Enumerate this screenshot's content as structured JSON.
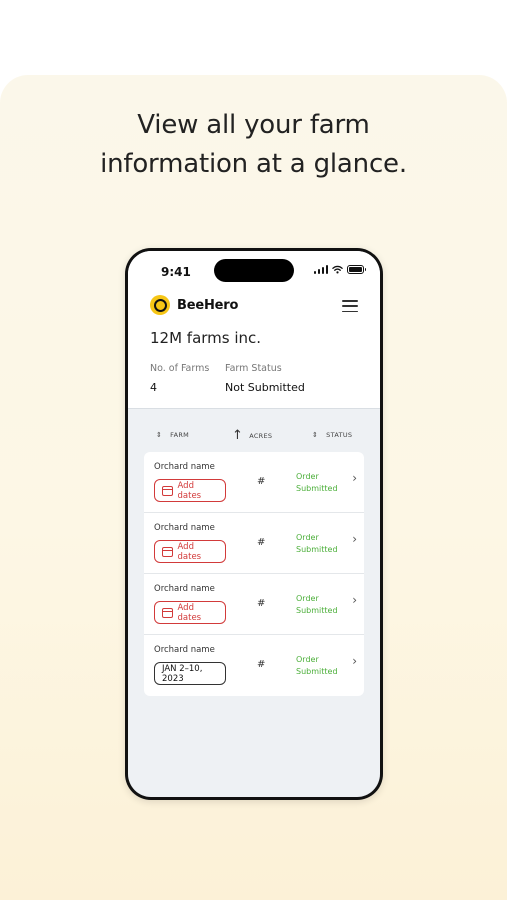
{
  "headline": {
    "line1": "View all your farm",
    "line2": "information at a glance."
  },
  "status_bar": {
    "time": "9:41"
  },
  "app": {
    "brand": "BeeHero",
    "company": "12M farms inc."
  },
  "stats": [
    {
      "label": "No. of Farms",
      "value": "4"
    },
    {
      "label": "Farm Status",
      "value": "Not Submitted"
    }
  ],
  "table": {
    "columns": {
      "farm": "FARM",
      "acres": "ACRES",
      "status": "STATUS"
    },
    "rows": [
      {
        "name": "Orchard name",
        "date": "Add dates",
        "acres": "#",
        "status_1": "Order",
        "status_2": "Submitted"
      },
      {
        "name": "Orchard name",
        "date": "Add dates",
        "acres": "#",
        "status_1": "Order",
        "status_2": "Submitted"
      },
      {
        "name": "Orchard name",
        "date": "Add dates",
        "acres": "#",
        "status_1": "Order",
        "status_2": "Submitted"
      },
      {
        "name": "Orchard name",
        "date": "JAN 2–10, 2023",
        "acres": "#",
        "status_1": "Order",
        "status_2": "Submitted"
      }
    ]
  },
  "colors": {
    "accent_yellow": "#f6c616",
    "alert_red": "#d23a3a",
    "success_green": "#4caf3a"
  },
  "icons": [
    "logo-icon",
    "menu-icon",
    "sort-icon",
    "arrow-up-icon",
    "calendar-icon",
    "chevron-right-icon",
    "signal-icon",
    "wifi-icon",
    "battery-icon"
  ]
}
